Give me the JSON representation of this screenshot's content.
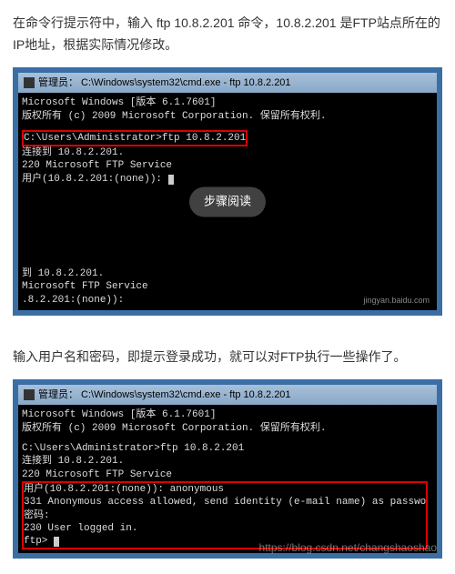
{
  "section1": {
    "desc": "在命令行提示符中，输入 ftp 10.8.2.201 命令，10.8.2.201 是FTP站点所在的IP地址，根据实际情况修改。",
    "titlebar": "管理员： C:\\Windows\\system32\\cmd.exe - ftp  10.8.2.201",
    "lines": {
      "l1": "Microsoft Windows [版本 6.1.7601]",
      "l2": "版权所有 (c) 2009 Microsoft Corporation. 保留所有权利.",
      "l3": "C:\\Users\\Administrator>ftp 10.8.2.201",
      "l4": "连接到 10.8.2.201.",
      "l5": "220 Microsoft FTP Service",
      "l6": "用户(10.8.2.201:(none)): ",
      "l7": "到 10.8.2.201.",
      "l8": "Microsoft FTP Service",
      "l9": ".8.2.201:(none)): "
    },
    "overlay_label": "步骤阅读",
    "watermark": "jingyan.baidu.com"
  },
  "section2": {
    "desc": "输入用户名和密码，即提示登录成功，就可以对FTP执行一些操作了。",
    "titlebar": "管理员： C:\\Windows\\system32\\cmd.exe - ftp  10.8.2.201",
    "lines": {
      "l1": "Microsoft Windows [版本 6.1.7601]",
      "l2": "版权所有 (c) 2009 Microsoft Corporation. 保留所有权利.",
      "l3": "C:\\Users\\Administrator>ftp 10.8.2.201",
      "l4": "连接到 10.8.2.201.",
      "l5": "220 Microsoft FTP Service",
      "l6": "用户(10.8.2.201:(none)): anonymous",
      "l7": "331 Anonymous access allowed, send identity (e-mail name) as passwo",
      "l8": "密码:",
      "l9": "230 User logged in.",
      "l10": "ftp> "
    },
    "watermark": "https://blog.csdn.net/changshaoshao"
  }
}
